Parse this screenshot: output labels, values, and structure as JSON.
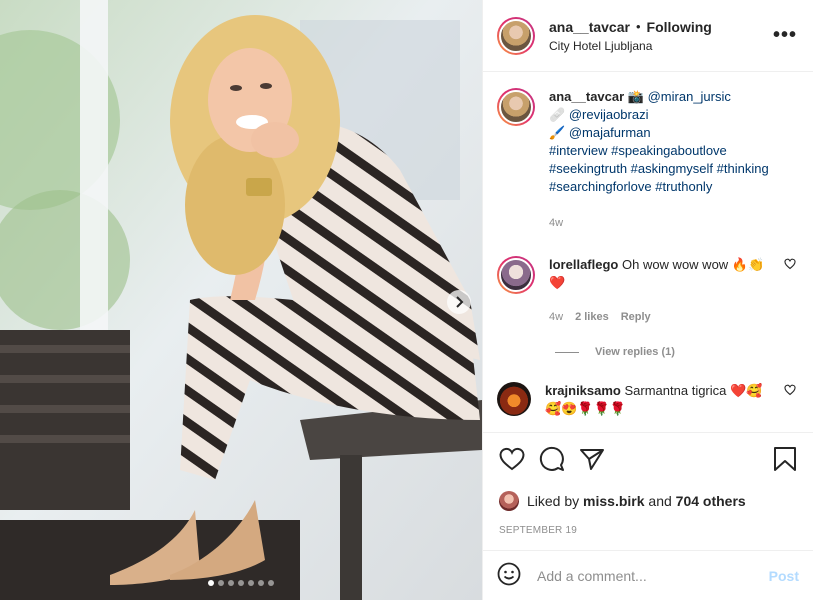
{
  "header": {
    "username": "ana__tavcar",
    "separator": "•",
    "following": "Following",
    "location": "City Hotel Ljubljana",
    "more": "•••"
  },
  "caption": {
    "username": "ana__tavcar",
    "line1_emoji": "📸",
    "line1_mention": "@miran_jursic",
    "line2_emoji": "🩹",
    "line2_mention": "@revijaobrazi",
    "line3_emoji": "🖌️",
    "line3_mention": "@majafurman",
    "line4": "#interview #speakingaboutlove",
    "line5": "#seekingtruth #askingmyself #thinking",
    "line6": "#searchingforlove #truthonly",
    "time": "4w"
  },
  "comments": [
    {
      "username": "lorellaflego",
      "text": "Oh wow wow wow 🔥👏",
      "text2": "❤️",
      "time": "4w",
      "likes": "2 likes",
      "reply": "Reply",
      "view_replies": "View replies (1)"
    },
    {
      "username": "krajniksamo",
      "text": "Sarmantna tigrica ❤️🥰",
      "text2": "🥰😍🌹🌹🌹"
    }
  ],
  "likes": {
    "prefix": "Liked by",
    "user": "miss.birk",
    "and": "and",
    "count": "704 others"
  },
  "date": "SEPTEMBER 19",
  "add_comment": {
    "placeholder": "Add a comment...",
    "post": "Post"
  },
  "carousel": {
    "count": 7,
    "active": 0
  }
}
